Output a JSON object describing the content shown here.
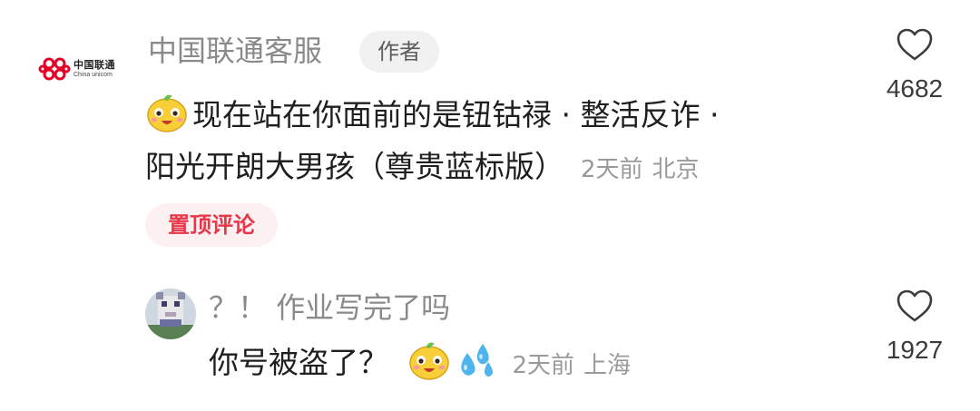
{
  "comments": [
    {
      "user_name": "中国联通客服",
      "author_badge": "作者",
      "avatar_brand_cn": "中国联通",
      "avatar_brand_en": "China unicom",
      "text_line1": "现在站在你面前的是钮钴禄 · 整活反诈 ·",
      "text_line2": "阳光开朗大男孩（尊贵蓝标版）",
      "time": "2天前",
      "location": "北京",
      "pinned_label": "置顶评论",
      "like_count": "4682",
      "emoji": "smiling-face-emoji"
    },
    {
      "user_name": "？！ 作业写完了吗",
      "text": "你号被盗了？",
      "time": "2天前",
      "location": "上海",
      "like_count": "1927",
      "emojis": [
        "smiling-face-emoji",
        "sweat-drops-emoji"
      ]
    }
  ],
  "colors": {
    "name_gray": "#8a8a8a",
    "pinned_red": "#e8364b",
    "pinned_bg": "#fdf0f1",
    "badge_bg": "#f1f1f2",
    "logo_red": "#e60027"
  },
  "icons": {
    "like": "heart-outline-icon"
  }
}
